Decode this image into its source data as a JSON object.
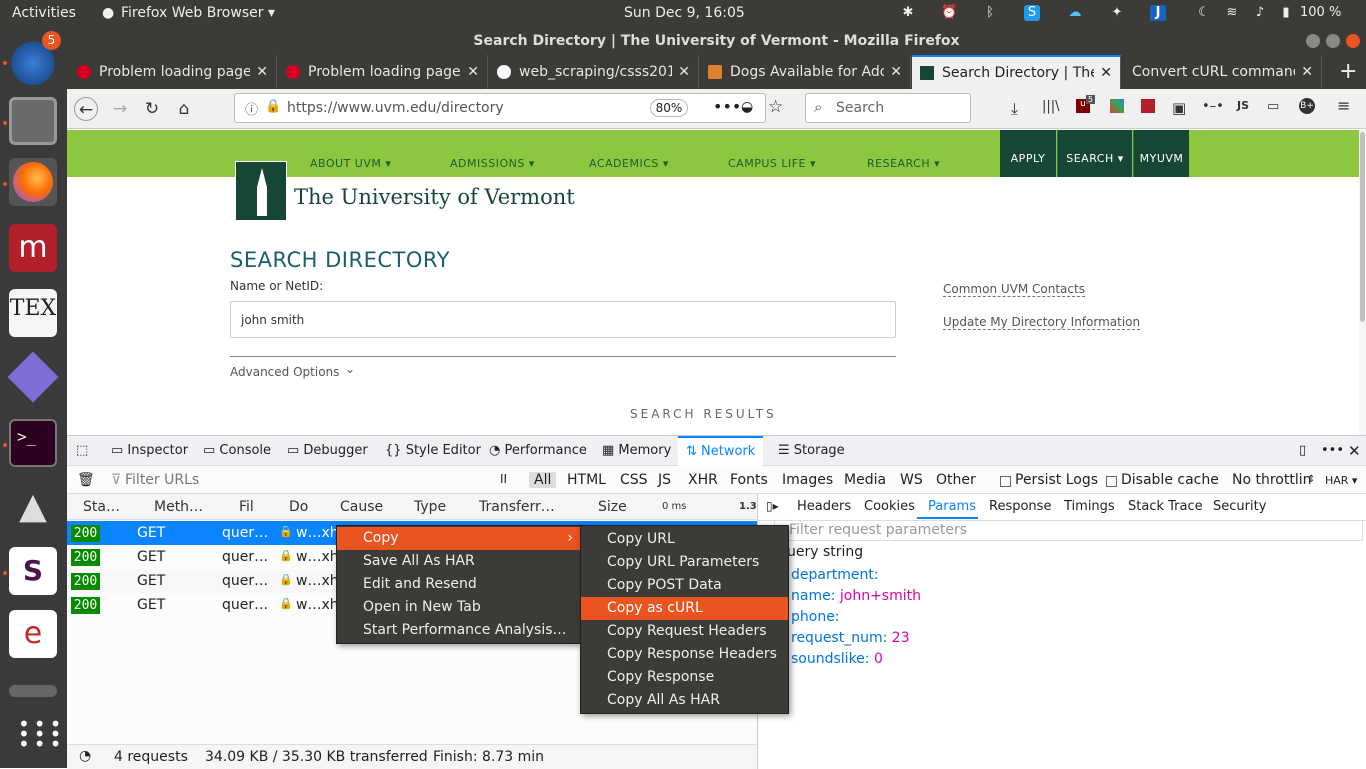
{
  "system": {
    "activities": "Activities",
    "app_menu": "Firefox Web Browser ▾",
    "clock": "Sun Dec  9, 16:05",
    "battery": "100 %",
    "dock_badge": "5"
  },
  "window": {
    "title": "Search Directory | The University of Vermont - Mozilla Firefox"
  },
  "tabs": [
    {
      "label": "Problem loading page",
      "icon_color": "#d70022"
    },
    {
      "label": "Problem loading page",
      "icon_color": "#d70022"
    },
    {
      "label": "web_scraping/csss201",
      "icon_color": "#ffffff"
    },
    {
      "label": "Dogs Available for Ado",
      "icon_color": "#e0812e"
    },
    {
      "label": "Search Directory | The U",
      "icon_color": "#154734"
    },
    {
      "label": "Convert cURL command s",
      "icon_color": "#888888"
    }
  ],
  "navbar": {
    "url": "https://www.uvm.edu/directory",
    "zoom": "80%",
    "search_placeholder": "Search",
    "badge": "5",
    "js_label": "JS"
  },
  "page": {
    "nav": [
      "ABOUT UVM ▾",
      "ADMISSIONS ▾",
      "ACADEMICS ▾",
      "CAMPUS LIFE ▾",
      "RESEARCH ▾"
    ],
    "buttons": [
      "APPLY",
      "SEARCH ▾",
      "MYUVM"
    ],
    "logo_text": "The University of Vermont",
    "heading": "SEARCH DIRECTORY",
    "field_label": "Name or NetID:",
    "field_value": "john smith",
    "advanced": "Advanced Options",
    "results": "SEARCH RESULTS",
    "links": [
      "Common UVM Contacts",
      "Update My Directory Information"
    ]
  },
  "devtools": {
    "tools": [
      "Inspector",
      "Console",
      "Debugger",
      "Style Editor",
      "Performance",
      "Memory",
      "Network",
      "Storage"
    ],
    "active_tool": "Network",
    "filter_placeholder": "Filter URLs",
    "pause": "II",
    "filters": [
      "All",
      "HTML",
      "CSS",
      "JS",
      "XHR",
      "Fonts",
      "Images",
      "Media",
      "WS",
      "Other"
    ],
    "persist_logs": "Persist Logs",
    "disable_cache": "Disable cache",
    "throttling": "No throttlin",
    "har": "HAR ▾",
    "columns": [
      "Sta…",
      "Meth…",
      "Fil",
      "Do",
      "Cause",
      "Type",
      "Transferr…",
      "Size",
      "0 ms",
      "1.3"
    ],
    "requests": [
      {
        "status": "200",
        "method": "GET",
        "file": "quer…",
        "domain": "w…xh"
      },
      {
        "status": "200",
        "method": "GET",
        "file": "quer…",
        "domain": "w…xh"
      },
      {
        "status": "200",
        "method": "GET",
        "file": "quer…",
        "domain": "w…xh"
      },
      {
        "status": "200",
        "method": "GET",
        "file": "quer…",
        "domain": "w…xh"
      }
    ],
    "side_tabs": [
      "Headers",
      "Cookies",
      "Params",
      "Response",
      "Timings",
      "Stack Trace",
      "Security"
    ],
    "active_side_tab": "Params",
    "param_filter_placeholder": "Filter request parameters",
    "query_title": "uery string",
    "params": [
      {
        "key": "department:",
        "value": ""
      },
      {
        "key": "name:",
        "value": "john+smith"
      },
      {
        "key": "phone:",
        "value": ""
      },
      {
        "key": "request_num:",
        "value": "23"
      },
      {
        "key": "soundslike:",
        "value": "0"
      }
    ],
    "status": {
      "count": "4 requests",
      "size": "34.09 KB / 35.30 KB transferred",
      "finish": "Finish: 8.73 min"
    }
  },
  "context_menu": {
    "items": [
      "Copy",
      "Save All As HAR",
      "Edit and Resend",
      "Open in New Tab",
      "Start Performance Analysis…"
    ],
    "submenu_arrow": "›",
    "submenu": [
      "Copy URL",
      "Copy URL Parameters",
      "Copy POST Data",
      "Copy as cURL",
      "Copy Request Headers",
      "Copy Response Headers",
      "Copy Response",
      "Copy All As HAR"
    ]
  },
  "colors": {
    "accent": "#0a84ff",
    "ubuntu_orange": "#e95420",
    "uvm_green": "#154734",
    "uvm_lime": "#8dc63f",
    "status_ok": "#058b00"
  }
}
